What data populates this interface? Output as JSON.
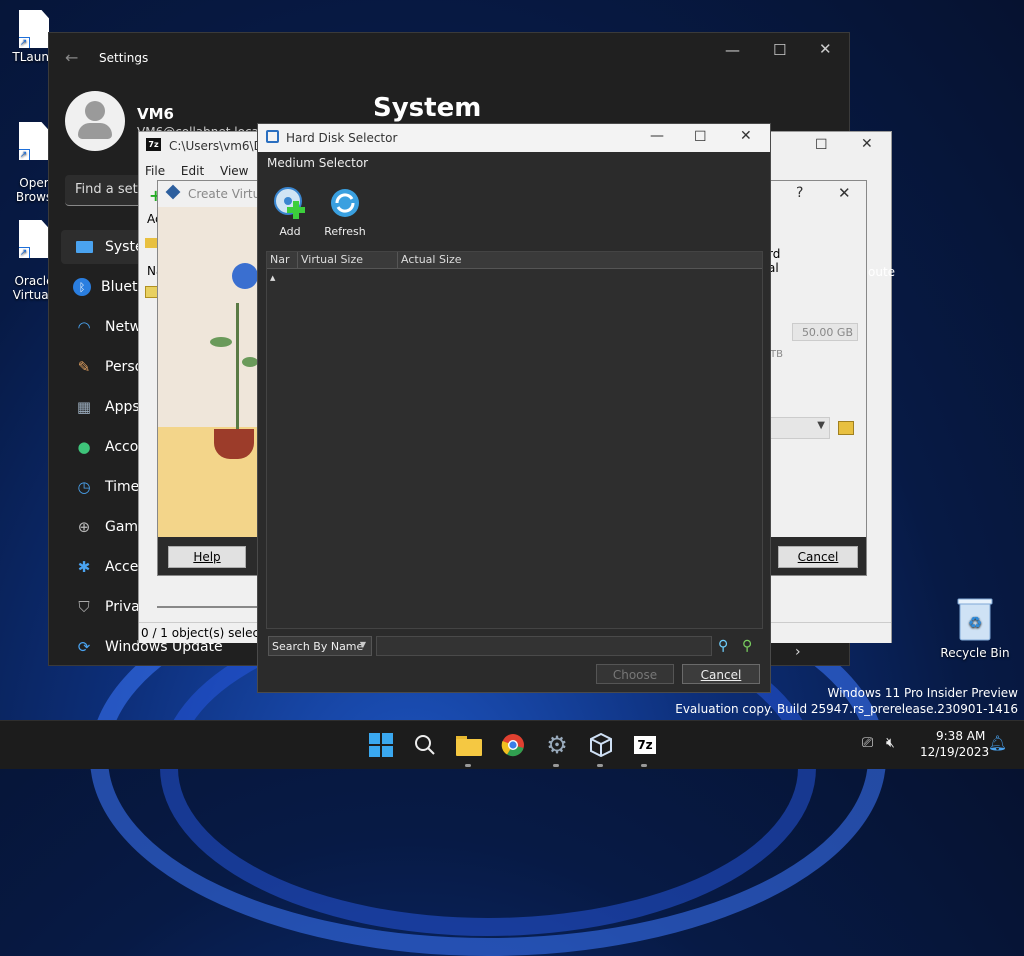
{
  "desktop": {
    "icons": [
      {
        "label": "TLaunc"
      },
      {
        "label": "Oper\nBrows"
      },
      {
        "label": "Oracle\nVirtuall"
      }
    ],
    "recycle_bin": "Recycle Bin",
    "watermark_line1": "Windows 11 Pro Insider Preview",
    "watermark_line2": "Evaluation copy. Build 25947.rs_prerelease.230901-1416"
  },
  "settings": {
    "title": "Settings",
    "user_name": "VM6",
    "user_email": "VM6@collabnet.local",
    "search_placeholder": "Find a sett",
    "page_title": "System",
    "nav": [
      {
        "label": "Syste",
        "icon": "monitor-icon"
      },
      {
        "label": "Bluet",
        "icon": "bluetooth-icon"
      },
      {
        "label": "Netw",
        "icon": "wifi-icon"
      },
      {
        "label": "Perso",
        "icon": "brush-icon"
      },
      {
        "label": "Apps",
        "icon": "apps-icon"
      },
      {
        "label": "Acco",
        "icon": "account-icon"
      },
      {
        "label": "Time",
        "icon": "clock-icon"
      },
      {
        "label": "Gam",
        "icon": "gamepad-icon"
      },
      {
        "label": "Acce",
        "icon": "accessibility-icon"
      },
      {
        "label": "Priva",
        "icon": "shield-icon"
      },
      {
        "label": "Windows Update",
        "icon": "update-icon"
      }
    ]
  },
  "sevenzip": {
    "path": "C:\\Users\\vm6\\Do",
    "menu": [
      "File",
      "Edit",
      "View",
      "F"
    ],
    "add_label": "Ac",
    "name_col": "Na",
    "status": "0 / 1 object(s) selected"
  },
  "createvm": {
    "title": "Create Virtua",
    "help": "Help",
    "cancel": "Cancel",
    "question": "?",
    "right_text_1": "rd",
    "right_text_2": "al",
    "right_text_3": "oute",
    "disk_size": "50.00 GB",
    "tb_label": "TB"
  },
  "hds": {
    "title": "Hard Disk Selector",
    "menu": "Medium Selector",
    "add": "Add",
    "refresh": "Refresh",
    "columns": [
      "Nar",
      "Virtual Size",
      "Actual Size"
    ],
    "search_mode": "Search By Name",
    "choose": "Choose",
    "cancel": "Cancel"
  },
  "taskbar": {
    "time": "9:38 AM",
    "date": "12/19/2023"
  }
}
